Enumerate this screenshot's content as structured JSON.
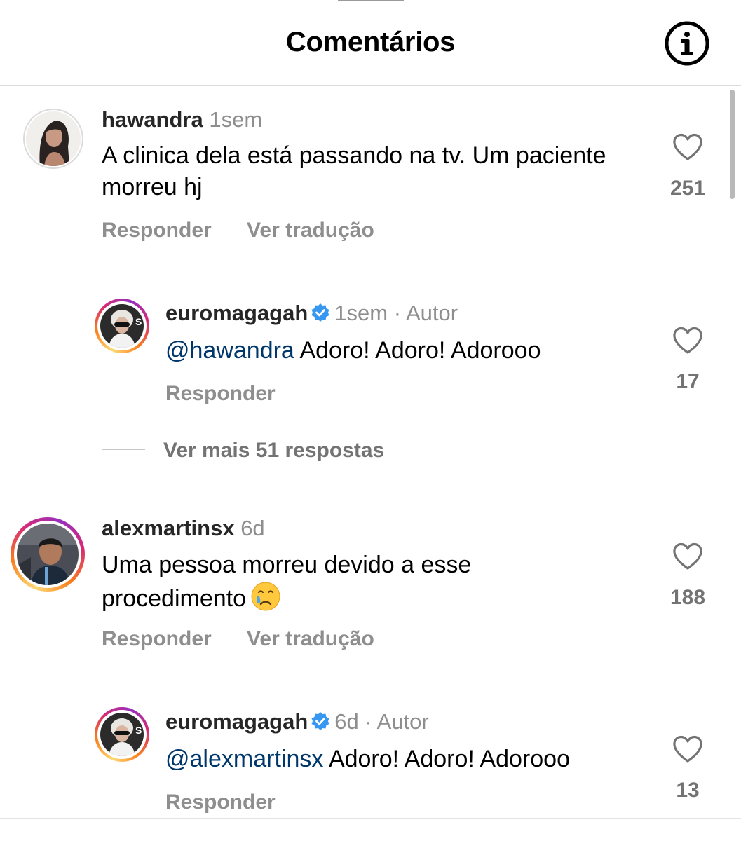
{
  "header": {
    "title": "Comentários",
    "info_icon": "info-circle-icon"
  },
  "comments": [
    {
      "username": "hawandra",
      "time": "1sem",
      "text": "A clinica dela está passando na tv. Um paciente morreu hj",
      "reply_label": "Responder",
      "translate_label": "Ver tradução",
      "likes": "251"
    },
    {
      "username": "euromagagah",
      "verified": true,
      "time": "1sem",
      "separator": "·",
      "author_label": "Autor",
      "mention": "@hawandra",
      "text": "Adoro! Adoro! Adorooo",
      "reply_label": "Responder",
      "likes": "17"
    },
    {
      "view_more": "Ver mais 51 respostas"
    },
    {
      "username": "alexmartinsx",
      "time": "6d",
      "text": "Uma pessoa morreu devido a esse procedimento",
      "emoji": "crying-face-emoji",
      "reply_label": "Responder",
      "translate_label": "Ver tradução",
      "likes": "188"
    },
    {
      "username": "euromagagah",
      "verified": true,
      "time": "6d",
      "separator": "·",
      "author_label": "Autor",
      "mention": "@alexmartinsx",
      "text": "Adoro! Adoro! Adorooo",
      "reply_label": "Responder",
      "likes": "13"
    }
  ],
  "colors": {
    "mention": "#00376b",
    "secondary_text": "#8e8e8e",
    "verified": "#3897f0",
    "divider": "#dbdbdb"
  }
}
